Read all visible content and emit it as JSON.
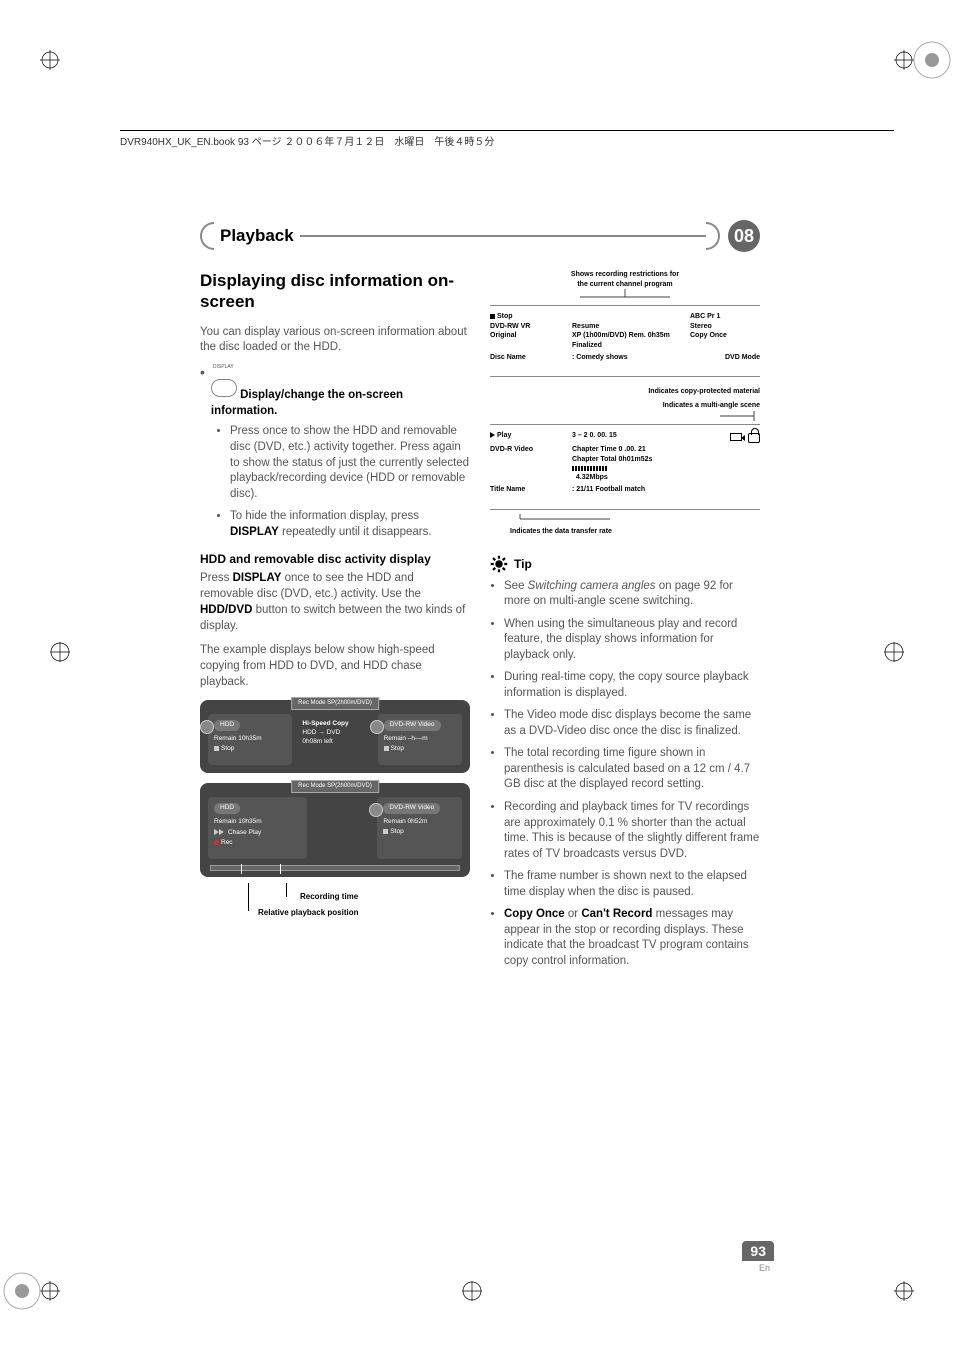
{
  "doc_header": "DVR940HX_UK_EN.book  93 ページ  ２００６年７月１２日　水曜日　午後４時５分",
  "chapter": {
    "title": "Playback",
    "number": "08"
  },
  "left": {
    "h2": "Displaying disc information on-screen",
    "intro": "You can display various on-screen information about the disc loaded or the HDD.",
    "step_button_label": "DISPLAY",
    "step_text": "Display/change the on-screen information.",
    "sub1": "Press once to show the HDD and removable disc (DVD, etc.) activity together. Press again to show the status of just the currently selected playback/recording device (HDD or removable disc).",
    "sub2_a": "To hide the information display, press ",
    "sub2_b": "DISPLAY",
    "sub2_c": " repeatedly until it disappears.",
    "subhead": "HDD and removable disc activity display",
    "para2_a": "Press ",
    "para2_b": "DISPLAY",
    "para2_c": " once to see the HDD and removable disc (DVD, etc.) activity. Use the ",
    "para2_d": "HDD/DVD",
    "para2_e": " button to switch between the two kinds of display.",
    "para3": "The example displays below show high-speed copying from HDD to DVD, and HDD chase playback.",
    "osd1": {
      "top": "Rec Mode   SP(2h00m/DVD)",
      "left_badge": "HDD",
      "left_l1": "Remain  10h35m",
      "left_l2": "Stop",
      "center_l1": "Hi-Speed Copy",
      "center_l2": "HDD → DVD",
      "center_l3": "0h08m left",
      "right_badge": "DVD-RW Video",
      "right_l1": "Remain  –h––m",
      "right_l2": "Stop"
    },
    "osd2": {
      "top": "Rec Mode   SP(2h00m/DVD)",
      "left_badge": "HDD",
      "left_l1": "Remain  10h35m",
      "left_l2": "Chase Play",
      "left_l3": "Rec",
      "right_badge": "DVD-RW Video",
      "right_l1": "Remain 0h52m",
      "right_l2": "Stop"
    },
    "cap1": "Recording time",
    "cap2": "Relative playback position"
  },
  "right": {
    "ann_top1": "Shows recording restrictions for",
    "ann_top2": "the current channel program",
    "block1": {
      "l1a": "Stop",
      "l1b": "",
      "l1c": "ABC  Pr 1",
      "l2a": "DVD-RW  VR",
      "l2b": "Resume",
      "l2c": "Stereo",
      "l3a": "Original",
      "l3b": "XP (1h00m/DVD)        Rem.     0h35m",
      "l3c": "Copy Once",
      "l4b": "Finalized",
      "l5a": "Disc Name",
      "l5b": ":  Comedy shows",
      "l5c": "DVD Mode"
    },
    "ann_mid1": "Indicates copy-protected material",
    "ann_mid2": "Indicates a multi-angle scene",
    "block2": {
      "l1a": "Play",
      "l1b": "3 – 2         0. 00. 15",
      "l2a": "DVD-R   Video",
      "l2b": "Chapter Time     0 .00. 21",
      "l3b": "Chapter Total    0h01m52s",
      "l4b": "4.32Mbps",
      "l5a": "Title Name",
      "l5b": ":  21/11 Football match"
    },
    "ann_bot": "Indicates the data transfer rate",
    "tip_label": "Tip",
    "tips": [
      {
        "pre": "See ",
        "it": "Switching camera angles",
        "post": " on page 92 for more on multi-angle scene switching."
      },
      {
        "text": "When using the simultaneous play and record feature, the display shows information for playback only."
      },
      {
        "text": "During real-time copy, the copy source playback information is displayed."
      },
      {
        "text": "The Video mode disc displays become the same as a DVD-Video disc once the disc is finalized."
      },
      {
        "text": "The total recording time figure shown in parenthesis is calculated based on a 12 cm / 4.7 GB disc at the displayed record setting."
      },
      {
        "text": "Recording and playback times for TV recordings are approximately 0.1 % shorter than the actual time. This is because of the slightly different frame rates of TV broadcasts versus DVD."
      },
      {
        "text": "The frame number is shown next to the elapsed time display when the disc is paused."
      },
      {
        "b1": "Copy Once",
        "mid": " or ",
        "b2": "Can't Record",
        "post": " messages may appear in the stop or recording displays. These indicate that the broadcast TV program contains copy control information."
      }
    ]
  },
  "page": {
    "num": "93",
    "lang": "En"
  }
}
